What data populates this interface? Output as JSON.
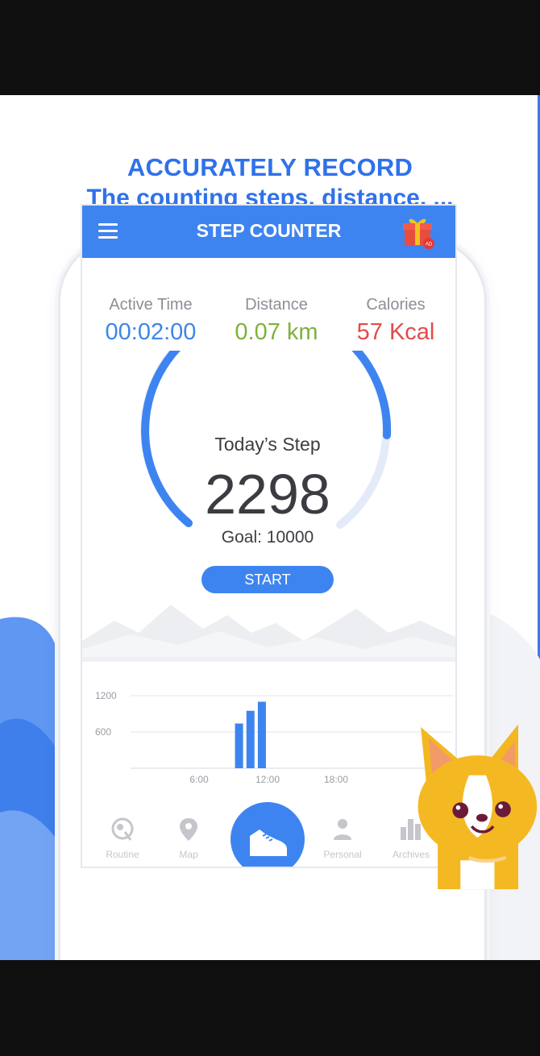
{
  "headline": {
    "line1": "ACCURATELY RECORD",
    "line2": "The counting steps, distance, ..."
  },
  "app": {
    "title": "STEP COUNTER",
    "menu_icon": "hamburger-menu-icon",
    "gift_icon": "gift-icon",
    "gift_badge": "AD"
  },
  "stats": {
    "active_time": {
      "label": "Active Time",
      "value": "00:02:00",
      "color": "#3d86e6"
    },
    "distance": {
      "label": "Distance",
      "value": "0.07 km",
      "color": "#7fb13c"
    },
    "calories": {
      "label": "Calories",
      "value": "57 Kcal",
      "color": "#e24b4b"
    }
  },
  "steps": {
    "label": "Today’s Step",
    "value": "2298",
    "goal": "Goal: 10000",
    "start_label": "START"
  },
  "chart_data": {
    "type": "bar",
    "x_ticks": [
      "6:00",
      "12:00",
      "18:00"
    ],
    "y_ticks": [
      "1200",
      "600"
    ],
    "xlim": [
      0,
      24
    ],
    "ylim": [
      0,
      1200
    ],
    "bars": [
      {
        "x": 9.5,
        "value": 740
      },
      {
        "x": 10.5,
        "value": 950
      },
      {
        "x": 11.5,
        "value": 1100
      }
    ],
    "color": "#3e84f0"
  },
  "nav": {
    "items": [
      {
        "label": "Routine",
        "icon": "routine-icon"
      },
      {
        "label": "Map",
        "icon": "map-pin-icon"
      },
      {
        "label": "",
        "icon": "shoe-icon"
      },
      {
        "label": "Personal",
        "icon": "person-icon"
      },
      {
        "label": "Archives",
        "icon": "archives-bar-icon"
      }
    ]
  },
  "colors": {
    "accent": "#3e84f0",
    "headline": "#2f71ea"
  }
}
